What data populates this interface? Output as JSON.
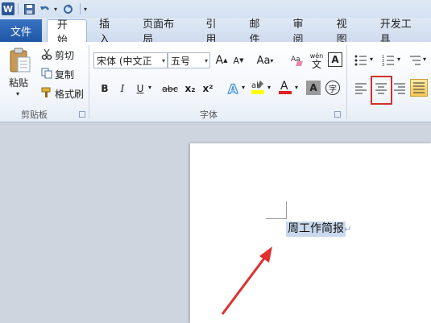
{
  "quick_access": {
    "logo": "W",
    "icons": [
      "save-icon",
      "undo-icon",
      "redo-icon",
      "customize-icon"
    ]
  },
  "tabs": {
    "file": "文件",
    "items": [
      "开始",
      "插入",
      "页面布局",
      "引用",
      "邮件",
      "审阅",
      "视图",
      "开发工具"
    ]
  },
  "clipboard": {
    "paste": "粘贴",
    "cut": "剪切",
    "copy": "复制",
    "format_painter": "格式刷",
    "label": "剪贴板"
  },
  "font": {
    "name": "宋体 (中文正",
    "size": "五号",
    "grow": "A",
    "shrink": "A",
    "change_case": "Aa",
    "bold": "B",
    "italic": "I",
    "underline": "U",
    "strike": "abc",
    "subscript": "x₂",
    "superscript": "x²",
    "pinyin_top": "wén",
    "pinyin_char": "文",
    "enclose_char": "字",
    "label": "字体"
  },
  "paragraph": {
    "align_active": "center"
  },
  "document": {
    "selected_text": "周工作简报",
    "para_mark": "↵"
  },
  "colors": {
    "accent_red": "#d0312d",
    "selection": "#c9d9ee",
    "file_tab": "#2b5fae"
  }
}
